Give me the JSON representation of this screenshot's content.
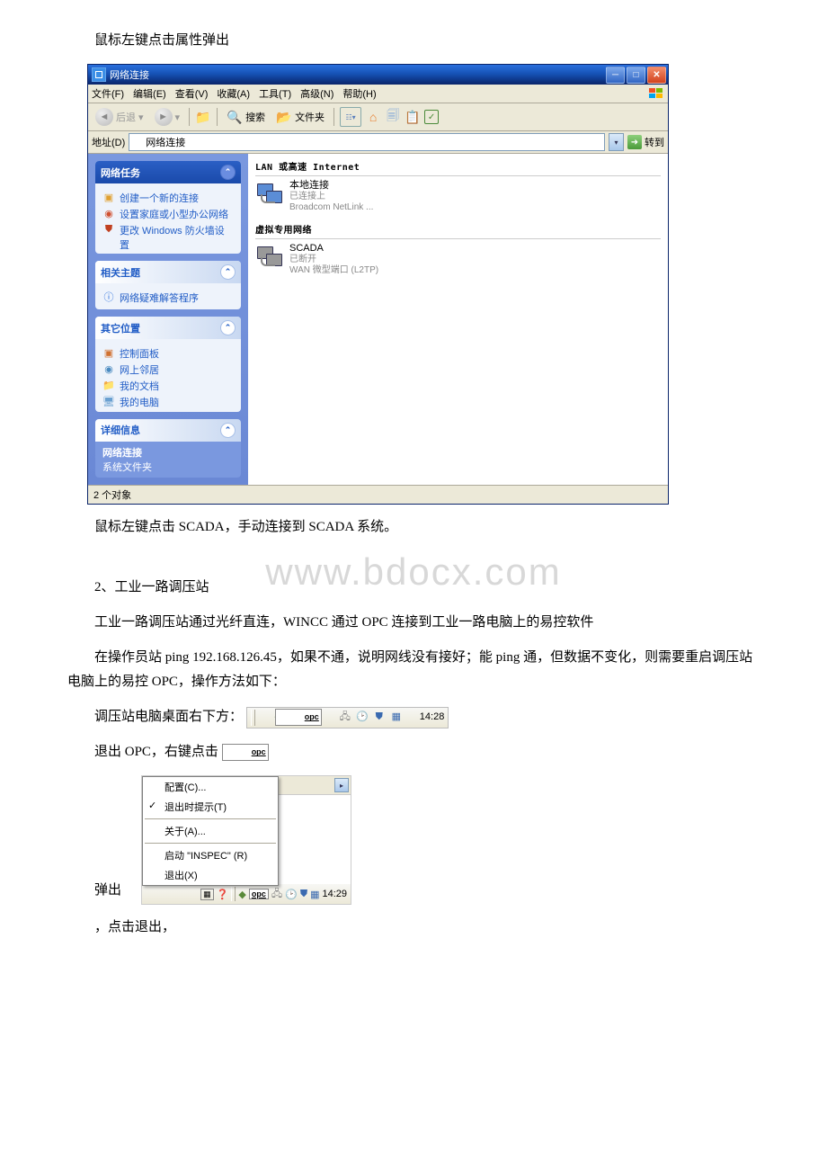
{
  "text": {
    "p1": "鼠标左键点击属性弹出",
    "p2": "鼠标左键点击 SCADA，手动连接到 SCADA 系统。",
    "p3": "2、工业一路调压站",
    "p4": "工业一路调压站通过光纤直连，WINCC 通过 OPC 连接到工业一路电脑上的易控软件",
    "p5": "在操作员站 ping 192.168.126.45，如果不通，说明网线没有接好；能 ping 通，但数据不变化，则需要重启调压站电脑上的易控 OPC，操作方法如下：",
    "p6a": "调压站电脑桌面右下方：",
    "p7a": "退出 OPC，右键点击",
    "p8a": "弹出",
    "p9": "，点击退出，"
  },
  "watermark": "www.bdocx.com",
  "window": {
    "title": "网络连接",
    "menus": {
      "file": "文件(F)",
      "edit": "编辑(E)",
      "view": "查看(V)",
      "fav": "收藏(A)",
      "tools": "工具(T)",
      "adv": "高级(N)",
      "help": "帮助(H)"
    },
    "toolbar": {
      "back": "后退",
      "search": "搜索",
      "folders": "文件夹"
    },
    "address": {
      "label": "地址(D)",
      "value": "网络连接",
      "go": "转到"
    },
    "panels": {
      "tasks": {
        "title": "网络任务",
        "items": [
          "创建一个新的连接",
          "设置家庭或小型办公网络",
          "更改 Windows 防火墙设置"
        ]
      },
      "related": {
        "title": "相关主题",
        "items": [
          "网络疑难解答程序"
        ]
      },
      "other": {
        "title": "其它位置",
        "items": [
          "控制面板",
          "网上邻居",
          "我的文档",
          "我的电脑"
        ]
      },
      "details": {
        "title": "详细信息",
        "name": "网络连接",
        "type": "系统文件夹"
      }
    },
    "content": {
      "sec1": "LAN 或高速 Internet",
      "conn1": {
        "name": "本地连接",
        "status": "已连接上",
        "device": "Broadcom NetLink ..."
      },
      "sec2": "虚拟专用网络",
      "conn2": {
        "name": "SCADA",
        "status": "已断开",
        "device": "WAN 微型端口 (L2TP)"
      }
    },
    "status": "2 个对象"
  },
  "tray": {
    "time": "14:28",
    "opc": "opc"
  },
  "ctx": {
    "items": {
      "config": "配置(C)...",
      "prompt": "退出时提示(T)",
      "about": "关于(A)...",
      "start": "启动 \"INSPEC\" (R)",
      "exit": "退出(X)"
    },
    "time": "14:29",
    "opc": "opc"
  }
}
